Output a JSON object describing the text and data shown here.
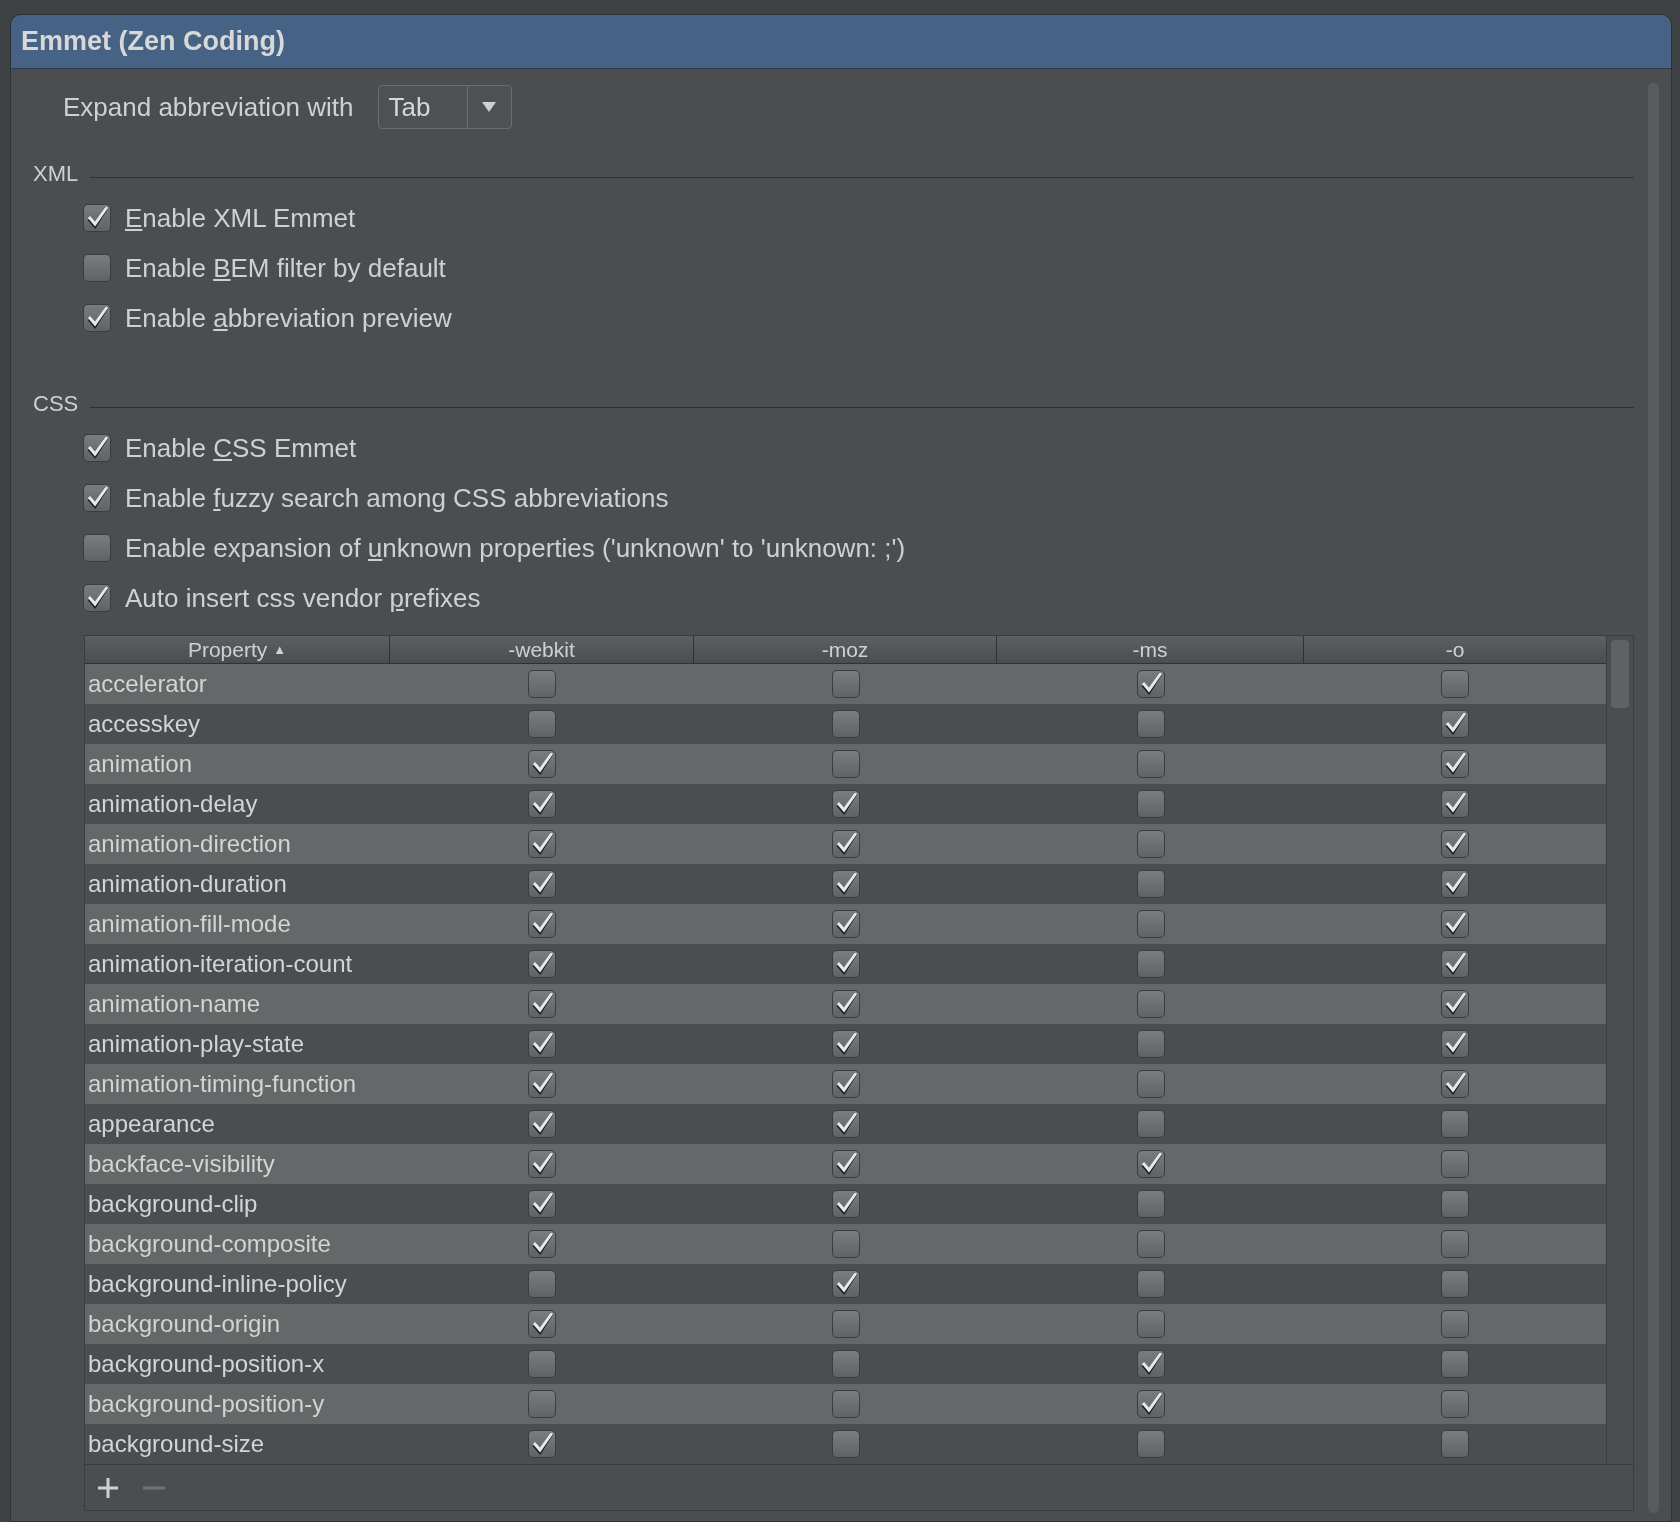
{
  "title": "Emmet (Zen Coding)",
  "expand": {
    "label": "Expand abbreviation with",
    "value": "Tab"
  },
  "sections": [
    {
      "title": "XML",
      "options": [
        {
          "mnemonic": "E",
          "after": "nable XML Emmet",
          "checked": true
        },
        {
          "before": "Enable ",
          "mnemonic": "B",
          "after": "EM filter by default",
          "checked": false
        },
        {
          "before": "Enable ",
          "mnemonic": "a",
          "after": "bbreviation preview",
          "checked": true
        }
      ]
    },
    {
      "title": "CSS",
      "options": [
        {
          "before": "Enable ",
          "mnemonic": "C",
          "after": "SS Emmet",
          "checked": true
        },
        {
          "before": "Enable ",
          "mnemonic": "f",
          "after": "uzzy search among CSS abbreviations",
          "checked": true
        },
        {
          "before": "Enable expansion of ",
          "mnemonic": "u",
          "after": "nknown properties ('unknown' to 'unknown: ;')",
          "checked": false
        },
        {
          "before": "Auto insert css vendor ",
          "mnemonic": "p",
          "after": "refixes",
          "checked": true
        }
      ]
    }
  ],
  "table": {
    "columns": [
      {
        "label": "Property",
        "sort_indicator": "▲"
      },
      {
        "label": "-webkit"
      },
      {
        "label": "-moz"
      },
      {
        "label": "-ms"
      },
      {
        "label": "-o"
      }
    ],
    "rows": [
      {
        "property": "accelerator",
        "prefixes": [
          false,
          false,
          true,
          false
        ]
      },
      {
        "property": "accesskey",
        "prefixes": [
          false,
          false,
          false,
          true
        ]
      },
      {
        "property": "animation",
        "prefixes": [
          true,
          false,
          false,
          true
        ]
      },
      {
        "property": "animation-delay",
        "prefixes": [
          true,
          true,
          false,
          true
        ]
      },
      {
        "property": "animation-direction",
        "prefixes": [
          true,
          true,
          false,
          true
        ]
      },
      {
        "property": "animation-duration",
        "prefixes": [
          true,
          true,
          false,
          true
        ]
      },
      {
        "property": "animation-fill-mode",
        "prefixes": [
          true,
          true,
          false,
          true
        ]
      },
      {
        "property": "animation-iteration-count",
        "prefixes": [
          true,
          true,
          false,
          true
        ]
      },
      {
        "property": "animation-name",
        "prefixes": [
          true,
          true,
          false,
          true
        ]
      },
      {
        "property": "animation-play-state",
        "prefixes": [
          true,
          true,
          false,
          true
        ]
      },
      {
        "property": "animation-timing-function",
        "prefixes": [
          true,
          true,
          false,
          true
        ]
      },
      {
        "property": "appearance",
        "prefixes": [
          true,
          true,
          false,
          false
        ]
      },
      {
        "property": "backface-visibility",
        "prefixes": [
          true,
          true,
          true,
          false
        ]
      },
      {
        "property": "background-clip",
        "prefixes": [
          true,
          true,
          false,
          false
        ]
      },
      {
        "property": "background-composite",
        "prefixes": [
          true,
          false,
          false,
          false
        ]
      },
      {
        "property": "background-inline-policy",
        "prefixes": [
          false,
          true,
          false,
          false
        ]
      },
      {
        "property": "background-origin",
        "prefixes": [
          true,
          false,
          false,
          false
        ]
      },
      {
        "property": "background-position-x",
        "prefixes": [
          false,
          false,
          true,
          false
        ]
      },
      {
        "property": "background-position-y",
        "prefixes": [
          false,
          false,
          true,
          false
        ]
      },
      {
        "property": "background-size",
        "prefixes": [
          true,
          false,
          false,
          false
        ]
      }
    ]
  }
}
